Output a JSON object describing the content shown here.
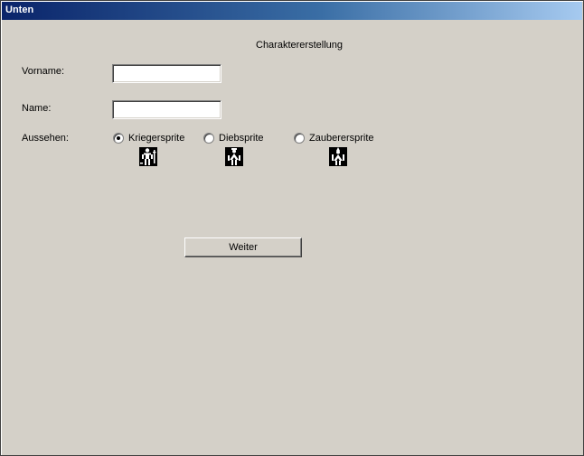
{
  "window": {
    "title": "Unten"
  },
  "form": {
    "heading": "Charaktererstellung",
    "vorname_label": "Vorname:",
    "vorname_value": "",
    "name_label": "Name:",
    "name_value": "",
    "aussehen_label": "Aussehen:",
    "options": [
      {
        "label": "Kriegersprite",
        "selected": true,
        "icon": "warrior-sprite-icon"
      },
      {
        "label": "Diebsprite",
        "selected": false,
        "icon": "thief-sprite-icon"
      },
      {
        "label": "Zauberersprite",
        "selected": false,
        "icon": "wizard-sprite-icon"
      }
    ],
    "button_label": "Weiter"
  }
}
